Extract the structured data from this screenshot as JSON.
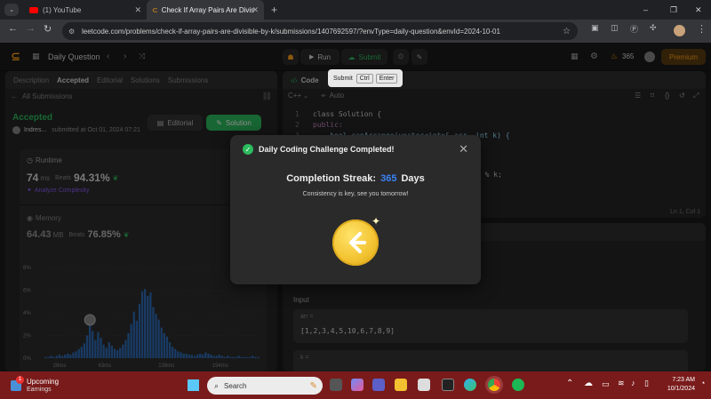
{
  "browser": {
    "tabs": [
      {
        "title": "(1) YouTube",
        "active": false
      },
      {
        "title": "Check If Array Pairs Are Divisib",
        "active": true
      }
    ],
    "new_tab": "+",
    "url": "leetcode.com/problems/check-if-array-pairs-are-divisible-by-k/submissions/1407692597/?envType=daily-question&envId=2024-10-01",
    "window_controls": [
      "–",
      "❐",
      "✕"
    ]
  },
  "header": {
    "title": "Daily Question",
    "run_label": "Run",
    "submit_label": "Submit",
    "streak_count": "365",
    "premium_label": "Premium",
    "tooltip": {
      "label": "Submit",
      "key1": "Ctrl",
      "key2": "Enter"
    }
  },
  "left": {
    "tabs": [
      "Description",
      "Accepted",
      "Editorial",
      "Solutions",
      "Submissions"
    ],
    "back_label": "All Submissions",
    "status": "Accepted",
    "user": "Indres...",
    "submitted": "submitted at Oct 01, 2024 07:21",
    "editorial_btn": "Editorial",
    "solution_btn": "Solution",
    "runtime": {
      "label": "Runtime",
      "value": "74",
      "unit": "ms",
      "beats_label": "Beats",
      "beats": "94.31%",
      "analyze": "Analyze Complexity"
    },
    "memory": {
      "label": "Memory",
      "value": "64.43",
      "unit": "MB",
      "beats_label": "Beats",
      "beats": "76.85%"
    }
  },
  "chart_data": {
    "type": "bar",
    "title": "",
    "xlabel": "",
    "ylabel": "",
    "y_ticks": [
      "8%",
      "6%",
      "4%",
      "2%",
      "0%"
    ],
    "ylim": [
      0,
      8
    ],
    "x_ticks": [
      "28ms",
      "63ms",
      "139ms",
      "194ms"
    ],
    "values": [
      0.1,
      0.1,
      0.2,
      0.1,
      0.2,
      0.3,
      0.2,
      0.3,
      0.4,
      0.3,
      0.5,
      0.6,
      0.8,
      1.0,
      1.3,
      2.0,
      2.9,
      2.4,
      1.6,
      2.3,
      1.8,
      1.2,
      0.9,
      1.4,
      1.1,
      0.8,
      0.7,
      0.9,
      1.2,
      1.6,
      2.2,
      3.0,
      4.1,
      3.3,
      4.8,
      5.9,
      6.1,
      5.5,
      5.8,
      4.5,
      3.9,
      3.4,
      2.7,
      2.2,
      1.9,
      1.4,
      1.0,
      0.8,
      0.6,
      0.5,
      0.4,
      0.4,
      0.3,
      0.3,
      0.2,
      0.3,
      0.4,
      0.3,
      0.5,
      0.4,
      0.3,
      0.2,
      0.2,
      0.3,
      0.2,
      0.1,
      0.2,
      0.1,
      0.1,
      0.1,
      0.2,
      0.1,
      0.1,
      0.1,
      0.1,
      0.2,
      0.1,
      0.1
    ],
    "highlight_index": 16,
    "bar_color": "#2f6bb5",
    "grid": true
  },
  "editor": {
    "tab": "Code",
    "language": "C++",
    "auto_label": "Auto",
    "status": "Ln 1, Col 1",
    "lines": [
      {
        "n": "1",
        "t": "class Solution {"
      },
      {
        "n": "2",
        "t": "public:"
      },
      {
        "n": "3",
        "t": "    bool canArrange(vector<int>& arr, int k) {"
      }
    ],
    "fragment": ") % k;"
  },
  "testcase": {
    "input_label": "Input",
    "arr_label": "arr =",
    "arr_value": "[1,2,3,4,5,10,6,7,8,9]",
    "k_label": "k ="
  },
  "modal": {
    "title": "Daily Coding Challenge Completed!",
    "streak_label": "Completion Streak:",
    "streak_value": "365",
    "streak_unit": "Days",
    "subtitle": "Consistency is key, see you tomorrow!"
  },
  "taskbar": {
    "weather_title": "Upcoming",
    "weather_sub": "Earnings",
    "badge": "1",
    "search_placeholder": "Search",
    "time": "7:23 AM",
    "date": "10/1/2024"
  },
  "colors": {
    "accent_green": "#2cbb5d",
    "streak_blue": "#3b82f6",
    "gold": "#f2c230",
    "orange": "#ffa116"
  }
}
